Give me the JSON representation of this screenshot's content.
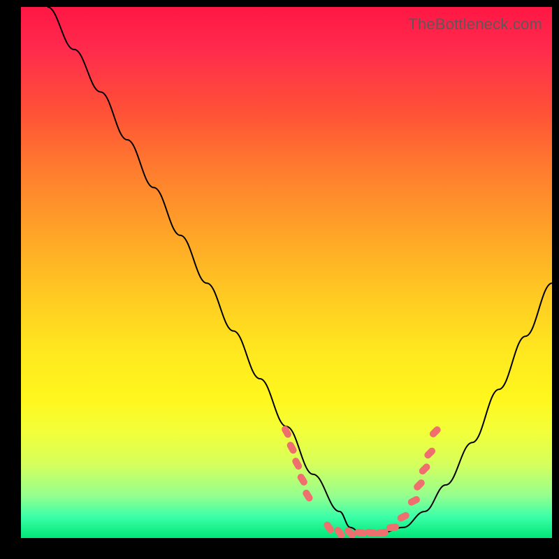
{
  "watermark": "TheBottleneck.com",
  "colors": {
    "page_bg": "#000000",
    "gradient_top": "#ff1744",
    "gradient_bottom": "#00e676",
    "curve": "#000000",
    "marker": "#ef6e6e",
    "watermark_text": "#5a5a5a"
  },
  "chart_data": {
    "type": "line",
    "title": "",
    "xlabel": "",
    "ylabel": "",
    "xlim": [
      0,
      100
    ],
    "ylim": [
      0,
      100
    ],
    "grid": false,
    "legend": false,
    "series": [
      {
        "name": "bottleneck-curve",
        "x": [
          5,
          10,
          15,
          20,
          25,
          30,
          35,
          40,
          45,
          50,
          55,
          60,
          62,
          64,
          68,
          72,
          76,
          80,
          85,
          90,
          95,
          100
        ],
        "y": [
          100,
          92,
          84,
          75,
          66,
          57,
          48,
          39,
          30,
          21,
          12,
          5,
          2,
          1,
          1,
          2,
          5,
          10,
          18,
          28,
          38,
          48
        ]
      }
    ],
    "markers": {
      "name": "highlighted-points",
      "note": "pink capsule-shaped markers near curve minimum",
      "x": [
        50,
        51,
        52,
        53,
        54,
        58,
        60,
        62,
        64,
        66,
        68,
        70,
        72,
        74,
        75,
        76,
        77,
        78
      ],
      "y": [
        20,
        17,
        14,
        11,
        8,
        2,
        1,
        1,
        1,
        1,
        1,
        2,
        4,
        7,
        10,
        13,
        16,
        20
      ]
    }
  }
}
